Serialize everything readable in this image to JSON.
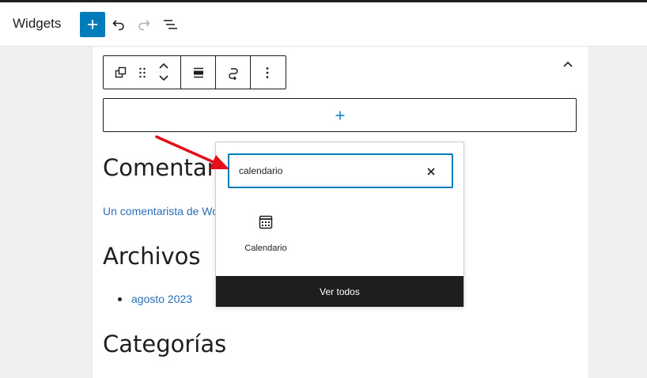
{
  "header": {
    "title": "Widgets",
    "add_icon": "plus-icon",
    "undo_icon": "undo-icon",
    "redo_icon": "redo-icon",
    "list_view_icon": "list-view-icon"
  },
  "block_toolbar": {
    "icons": [
      "transform-icon",
      "drag-handle-icon",
      "move-up-icon",
      "move-down-icon",
      "align-icon",
      "link-icon",
      "more-options-icon"
    ]
  },
  "widget_area": {
    "collapse_icon": "chevron-up-icon",
    "appender_icon": "plus-icon"
  },
  "content": {
    "heading_comments": "Comentarios",
    "comment_link": "Un comentarista de WordPress",
    "heading_archives": "Archivos",
    "archive_link": "agosto 2023",
    "heading_categories": "Categorías"
  },
  "inserter": {
    "search_value": "calendario",
    "clear_icon": "close-icon",
    "results": [
      {
        "label": "Calendario",
        "icon": "calendar-icon"
      }
    ],
    "view_all_label": "Ver todos"
  },
  "colors": {
    "accent": "#007cba",
    "link": "#2a6fb8",
    "annotation_arrow": "#e3101a",
    "dark": "#1e1e1e"
  }
}
